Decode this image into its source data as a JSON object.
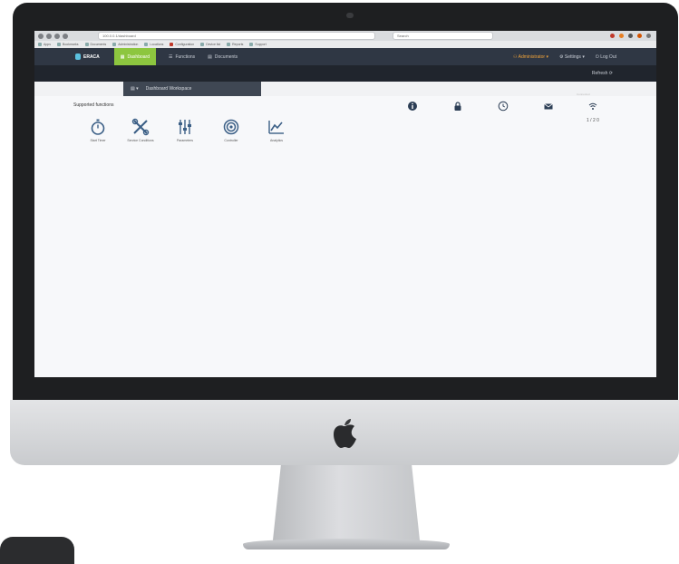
{
  "browser": {
    "url": "100.0.0.1/dashboard",
    "active_tab": "Dashboard",
    "search_placeholder": "Search",
    "bookmarks": [
      "Apps",
      "Bookmarks",
      "Documents",
      "Administration",
      "Locations",
      "Configuration",
      "Device list",
      "Reports",
      "Support"
    ]
  },
  "app": {
    "brand": "ERACA",
    "nav": [
      "Dashboard",
      "Functions",
      "Documents"
    ],
    "user": "Administrator",
    "settings": "Settings",
    "logout": "Log Out",
    "subbar_label": "Refresh"
  },
  "toolbar": {
    "path_label": "Dashboard Workspace"
  },
  "content": {
    "section_title": "Supported functions",
    "tiles": [
      "Start Timer",
      "Service Conditions",
      "Parameters",
      "Controller",
      "Analytics"
    ],
    "status_count": "1 / 2 0",
    "status_note": "Connected"
  },
  "colors": {
    "nav_bg": "#2f3744",
    "accent_green": "#8dc63f",
    "user_orange": "#f0a33a",
    "icon_blue": "#3b5f86"
  },
  "icons": {
    "status": [
      "info-icon",
      "lock-icon",
      "clock-icon",
      "mail-icon",
      "wifi-icon"
    ]
  }
}
